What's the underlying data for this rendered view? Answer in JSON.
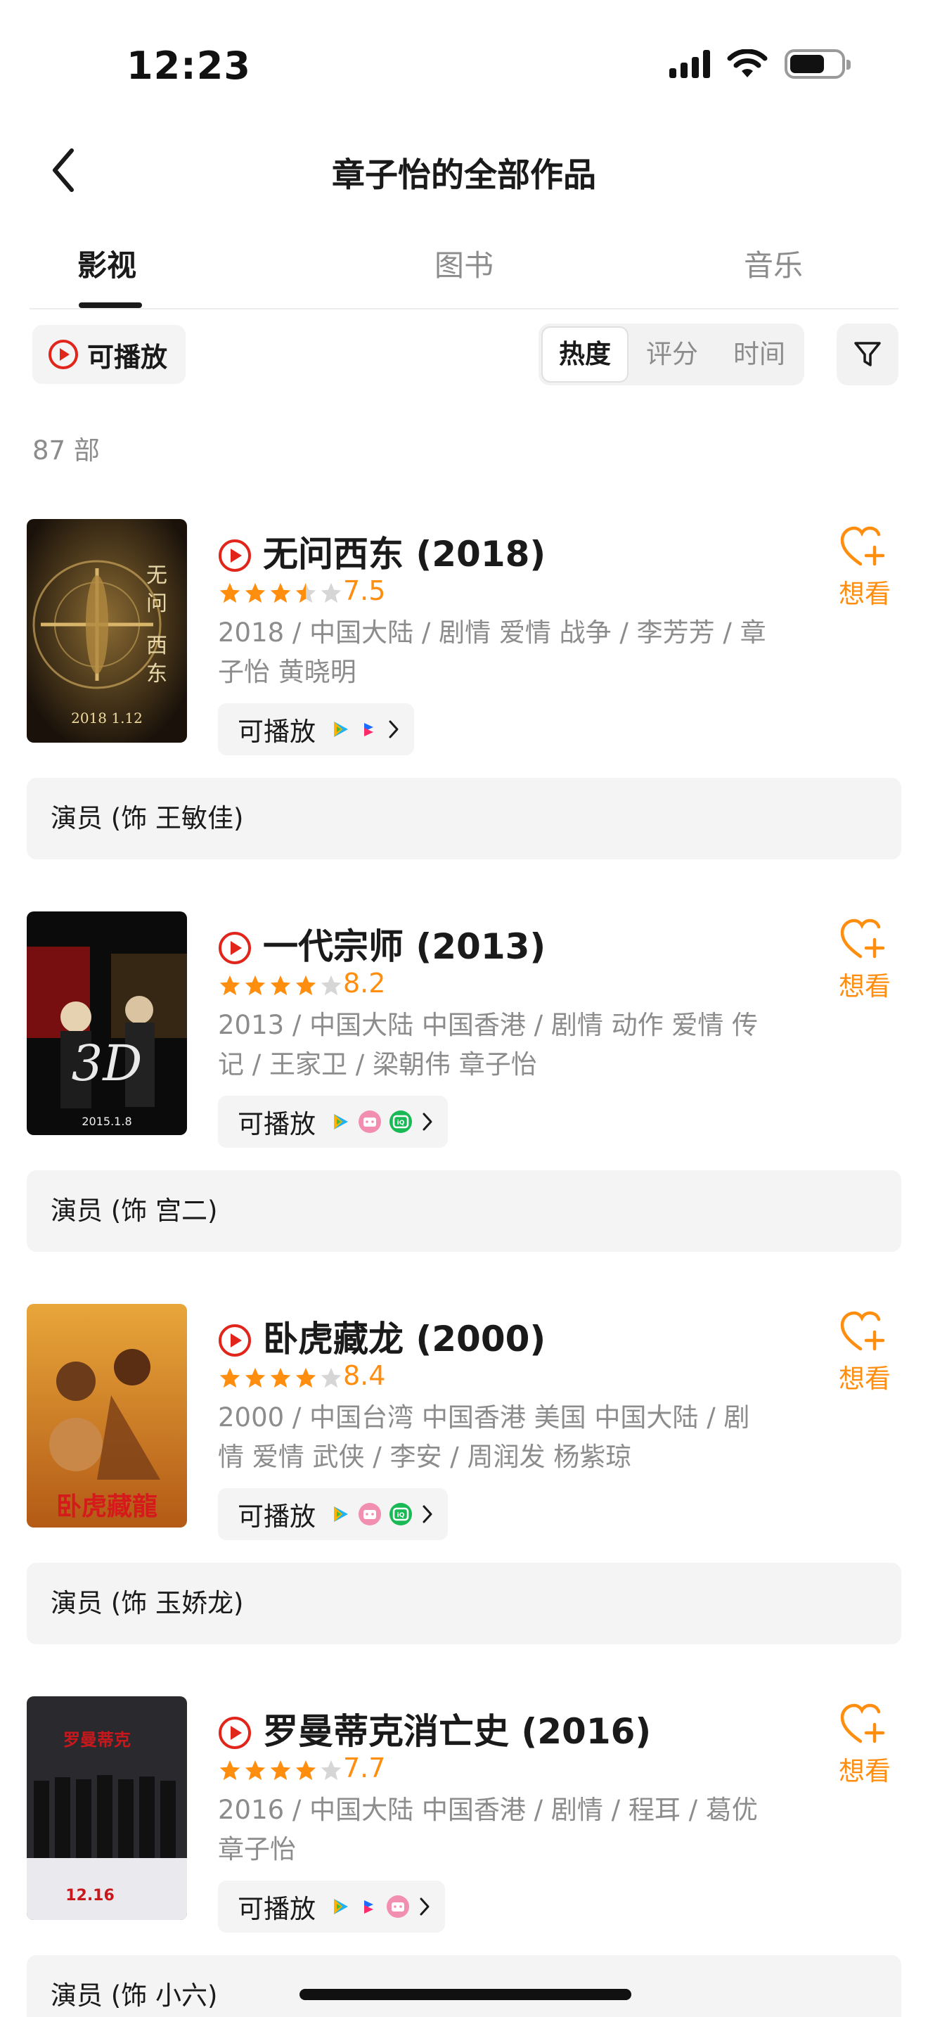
{
  "status_bar": {
    "time": "12:23"
  },
  "header": {
    "title": "章子怡的全部作品"
  },
  "tabs": [
    {
      "label": "影视",
      "active": true
    },
    {
      "label": "图书",
      "active": false
    },
    {
      "label": "音乐",
      "active": false
    }
  ],
  "filters": {
    "playable_label": "可播放",
    "sort": [
      {
        "label": "热度",
        "active": true
      },
      {
        "label": "评分",
        "active": false
      },
      {
        "label": "时间",
        "active": false
      }
    ]
  },
  "count_text": "87 部",
  "colors": {
    "accent": "#ff8d0e",
    "play_red": "#e1251b",
    "text": "#1a1a1a",
    "muted": "#8c8c8c",
    "chip_bg": "#f4f4f4"
  },
  "items": [
    {
      "title": "无问西东 (2018)",
      "stars": 4,
      "rating": "7.5",
      "meta_line1": "2018 / 中国大陆 / 剧情 爱情 战争 / 李芳芳 / 章",
      "meta_line2": "子怡 黄晓明",
      "play_label": "可播放",
      "platforms": [
        "tencent-video-icon",
        "youku-icon"
      ],
      "want_label": "想看",
      "role": "演员 (饰 王敏佳)",
      "poster_date": "2018 1.12"
    },
    {
      "title": "一代宗师 (2013)",
      "stars": 4,
      "rating": "8.2",
      "meta_line1": "2013 / 中国大陆 中国香港 / 剧情 动作 爱情 传",
      "meta_line2": "记 / 王家卫 / 梁朝伟 章子怡",
      "play_label": "可播放",
      "platforms": [
        "tencent-video-icon",
        "bilibili-icon",
        "iqiyi-icon"
      ],
      "want_label": "想看",
      "role": "演员 (饰 宫二)",
      "poster_date": "2015.1.8"
    },
    {
      "title": "卧虎藏龙 (2000)",
      "stars": 4,
      "rating": "8.4",
      "meta_line1": "2000 / 中国台湾 中国香港 美国 中国大陆 / 剧",
      "meta_line2": "情 爱情 武侠 / 李安 / 周润发 杨紫琼",
      "play_label": "可播放",
      "platforms": [
        "tencent-video-icon",
        "bilibili-icon",
        "iqiyi-icon"
      ],
      "want_label": "想看",
      "role": "演员 (饰 玉娇龙)",
      "poster_title": "卧虎藏龍"
    },
    {
      "title": "罗曼蒂克消亡史 (2016)",
      "stars": 4,
      "rating": "7.7",
      "meta_line1": "2016 / 中国大陆 中国香港 / 剧情 / 程耳 / 葛优",
      "meta_line2": "章子怡",
      "play_label": "可播放",
      "platforms": [
        "tencent-video-icon",
        "youku-icon",
        "bilibili-icon"
      ],
      "want_label": "想看",
      "role": "演员 (饰 小六)",
      "poster_date": "12.16"
    }
  ]
}
